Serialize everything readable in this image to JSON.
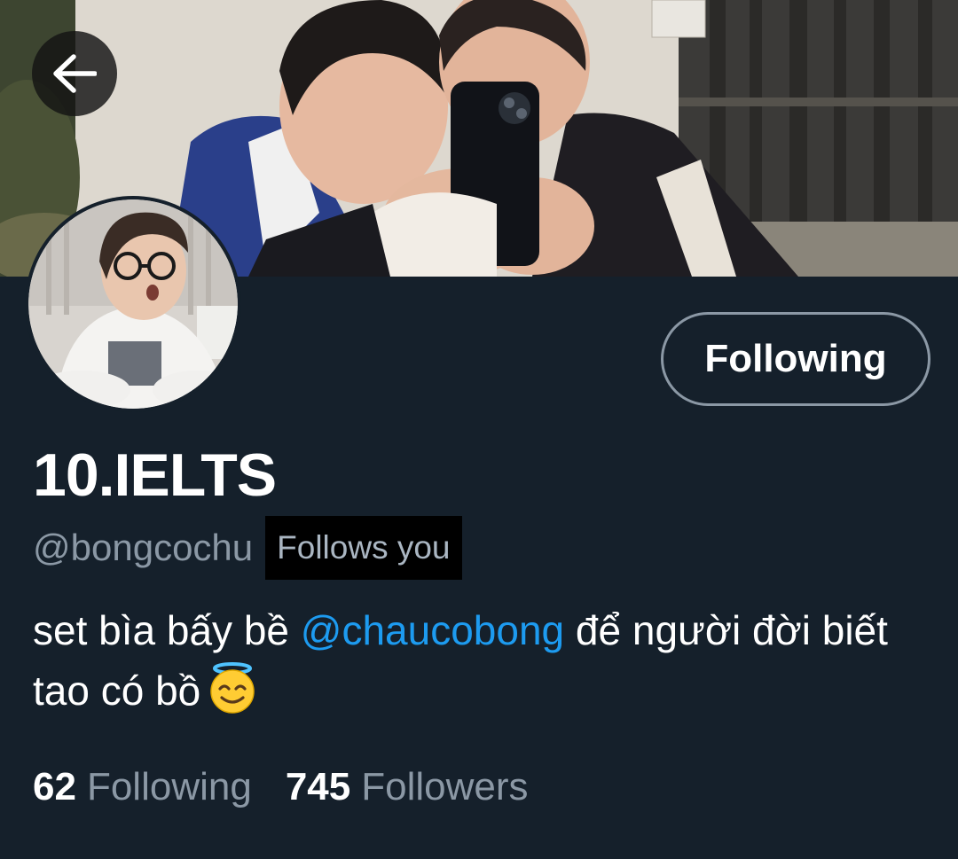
{
  "profile": {
    "display_name": "10.IELTS",
    "handle": "@bongcochu",
    "follows_you_badge": "Follows you",
    "follow_button_label": "Following",
    "bio": {
      "part1": "set bìa bấy bề ",
      "mention": "@chaucobong",
      "part2": " để người đời biết tao có bồ",
      "emoji": "smiling-face-with-halo-icon"
    },
    "stats": {
      "following_count": "62",
      "following_label": "Following",
      "followers_count": "745",
      "followers_label": "Followers"
    }
  },
  "icons": {
    "back": "back-arrow-icon"
  },
  "colors": {
    "background": "#15202b",
    "accent": "#1d9bf0",
    "secondary_text": "#8b98a5",
    "button_border": "#8b98a5"
  }
}
